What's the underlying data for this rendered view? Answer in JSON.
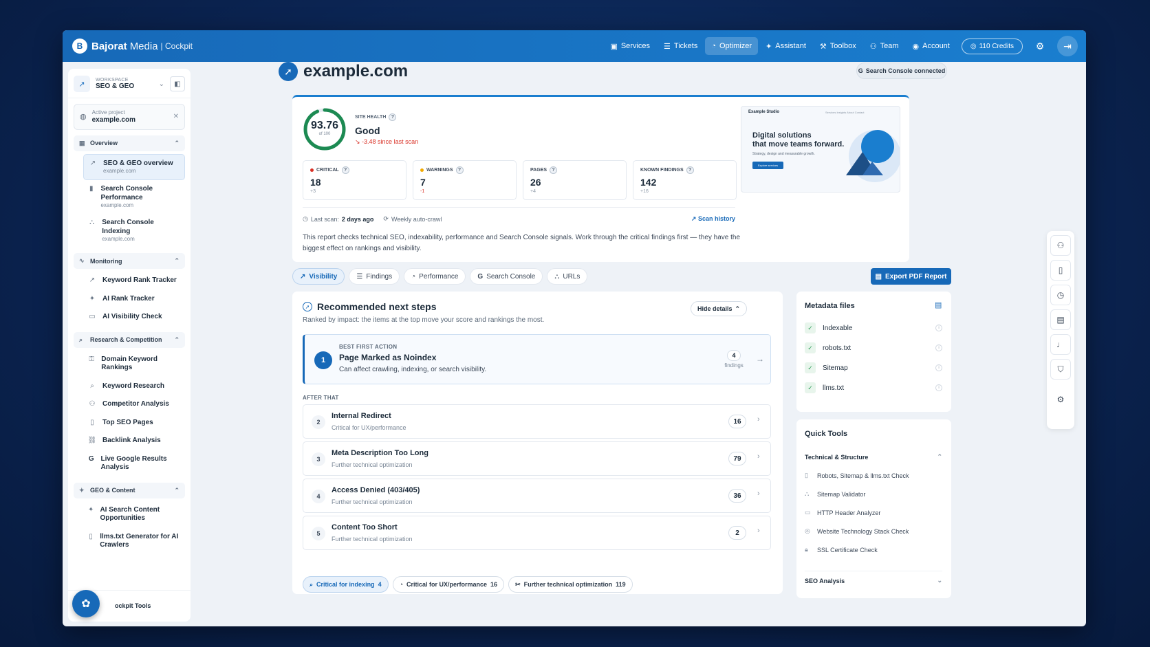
{
  "brand": {
    "logo": "B",
    "name": "Bajorat",
    "name2": "Media",
    "sub": "| Cockpit"
  },
  "nav": {
    "items": [
      {
        "icon": "▣",
        "label": "Services"
      },
      {
        "icon": "☰",
        "label": "Tickets"
      },
      {
        "icon": "◔",
        "label": "Optimizer"
      },
      {
        "icon": "✦",
        "label": "Assistant"
      },
      {
        "icon": "⚒",
        "label": "Toolbox"
      },
      {
        "icon": "⚇",
        "label": "Team"
      },
      {
        "icon": "◉",
        "label": "Account"
      }
    ],
    "credits_icon": "◎",
    "credits": "110 Credits",
    "settings_icon": "⚙",
    "logout_icon": "⇥"
  },
  "sidebar": {
    "workspace_label": "WORKSPACE",
    "workspace_value": "SEO & GEO",
    "project_label": "Active project",
    "project_value": "example.com",
    "sections": {
      "overview": "Overview",
      "monitoring": "Monitoring",
      "research": "Research & Competition",
      "geo": "GEO & Content"
    },
    "overview_items": [
      {
        "label": "SEO & GEO overview",
        "sub": "example.com"
      },
      {
        "label": "Search Console Performance",
        "sub": "example.com"
      },
      {
        "label": "Search Console Indexing",
        "sub": "example.com"
      }
    ],
    "monitoring_items": [
      "Keyword Rank Tracker",
      "AI Rank Tracker",
      "AI Visibility Check"
    ],
    "research_items": [
      "Domain Keyword Rankings",
      "Keyword Research",
      "Competitor Analysis",
      "Top SEO Pages",
      "Backlink Analysis",
      "Live Google Results Analysis"
    ],
    "geo_items": [
      "AI Search Content Opportunities",
      "llms.txt Generator for AI Crawlers"
    ],
    "footer": "ockpit Tools"
  },
  "page": {
    "title": "example.com",
    "sc_badge": "Search Console connected"
  },
  "health": {
    "score": 93.76,
    "score_text": "93.76",
    "of": "of 100",
    "label": "SITE HEALTH",
    "value": "Good",
    "delta": "↘ -3.48 since last scan",
    "stats": [
      {
        "label": "CRITICAL",
        "value": "18",
        "delta": "+3",
        "color": "#d93025"
      },
      {
        "label": "WARNINGS",
        "value": "7",
        "delta": "-1",
        "color": "#f2a900"
      },
      {
        "label": "PAGES",
        "value": "26",
        "delta": "+4",
        "color": ""
      },
      {
        "label": "KNOWN FINDINGS",
        "value": "142",
        "delta": "+16",
        "color": ""
      }
    ],
    "last_scan_label": "Last scan:",
    "last_scan_value": "2 days ago",
    "crawl": "Weekly auto-crawl",
    "history": "Scan history",
    "description": "This report checks technical SEO, indexability, performance and Search Console signals. Work through the critical findings first — they have the biggest effect on rankings and visibility."
  },
  "preview": {
    "name": "Example Studio",
    "menu": "Services Insights About Contact",
    "headline1": "Digital solutions",
    "headline2": "that move teams forward.",
    "sub": "Strategy, design and measurable growth.",
    "button": "Explore services"
  },
  "tabs": [
    {
      "icon": "↗",
      "label": "Visibility"
    },
    {
      "icon": "☰",
      "label": "Findings"
    },
    {
      "icon": "◔",
      "label": "Performance"
    },
    {
      "icon": "G",
      "label": "Search Console"
    },
    {
      "icon": "⛬",
      "label": "URLs"
    }
  ],
  "export": "Export PDF Report",
  "steps": {
    "title": "Recommended next steps",
    "subtitle": "Ranked by impact: the items at the top move your score and rankings the most.",
    "hide": "Hide details",
    "best_label": "BEST FIRST ACTION",
    "best_title": "Page Marked as Noindex",
    "best_sub": "Can affect crawling, indexing, or search visibility.",
    "best_count": "4",
    "best_findings": "findings",
    "after": "AFTER THAT",
    "rows": [
      {
        "n": "2",
        "title": "Internal Redirect",
        "sub": "Critical for UX/performance",
        "count": "16"
      },
      {
        "n": "3",
        "title": "Meta Description Too Long",
        "sub": "Further technical optimization",
        "count": "79"
      },
      {
        "n": "4",
        "title": "Access Denied (403/405)",
        "sub": "Further technical optimization",
        "count": "36"
      },
      {
        "n": "5",
        "title": "Content Too Short",
        "sub": "Further technical optimization",
        "count": "2"
      }
    ],
    "chips": [
      {
        "label": "Critical for indexing",
        "count": "4"
      },
      {
        "label": "Critical for UX/performance",
        "count": "16"
      },
      {
        "label": "Further technical optimization",
        "count": "119"
      }
    ]
  },
  "metadata": {
    "title": "Metadata files",
    "items": [
      "Indexable",
      "robots.txt",
      "Sitemap",
      "llms.txt"
    ]
  },
  "quick_tools": {
    "title": "Quick Tools",
    "group": "Technical & Structure",
    "items": [
      "Robots, Sitemap & llms.txt Check",
      "Sitemap Validator",
      "HTTP Header Analyzer",
      "Website Technology Stack Check",
      "SSL Certificate Check"
    ],
    "group2": "SEO Analysis"
  }
}
